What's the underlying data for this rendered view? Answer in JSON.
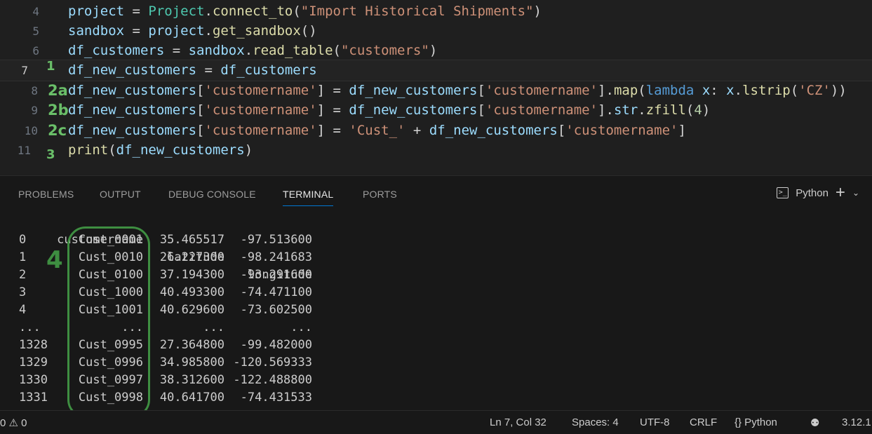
{
  "editor": {
    "lines": [
      {
        "num": "4",
        "ann": "",
        "code": [
          [
            "var",
            "project"
          ],
          [
            "op",
            " = "
          ],
          [
            "cls",
            "Project"
          ],
          [
            "op",
            "."
          ],
          [
            "fn",
            "connect_to"
          ],
          [
            "op",
            "("
          ],
          [
            "str",
            "\"Import Historical Shipments\""
          ],
          [
            "op",
            ")"
          ]
        ]
      },
      {
        "num": "5",
        "ann": "",
        "code": [
          [
            "var",
            "sandbox"
          ],
          [
            "op",
            " = "
          ],
          [
            "var",
            "project"
          ],
          [
            "op",
            "."
          ],
          [
            "fn",
            "get_sandbox"
          ],
          [
            "op",
            "()"
          ]
        ]
      },
      {
        "num": "6",
        "ann": "",
        "code": [
          [
            "var",
            "df_customers"
          ],
          [
            "op",
            " = "
          ],
          [
            "var",
            "sandbox"
          ],
          [
            "op",
            "."
          ],
          [
            "fn",
            "read_table"
          ],
          [
            "op",
            "("
          ],
          [
            "str",
            "\"customers\""
          ],
          [
            "op",
            ")"
          ]
        ]
      },
      {
        "num": "7",
        "ann": "1",
        "code": [
          [
            "var",
            "df_new_customers"
          ],
          [
            "op",
            " = "
          ],
          [
            "var",
            "df_customers"
          ]
        ]
      },
      {
        "num": "8",
        "ann": "2a",
        "code": [
          [
            "var",
            "df_new_customers"
          ],
          [
            "op",
            "["
          ],
          [
            "str",
            "'customername'"
          ],
          [
            "op",
            "] = "
          ],
          [
            "var",
            "df_new_customers"
          ],
          [
            "op",
            "["
          ],
          [
            "str",
            "'customername'"
          ],
          [
            "op",
            "]."
          ],
          [
            "fn",
            "map"
          ],
          [
            "op",
            "("
          ],
          [
            "kw",
            "lambda"
          ],
          [
            "op",
            " "
          ],
          [
            "var",
            "x"
          ],
          [
            "op",
            ": "
          ],
          [
            "var",
            "x"
          ],
          [
            "op",
            "."
          ],
          [
            "fn",
            "lstrip"
          ],
          [
            "op",
            "("
          ],
          [
            "str",
            "'CZ'"
          ],
          [
            "op",
            "))"
          ]
        ]
      },
      {
        "num": "9",
        "ann": "2b",
        "code": [
          [
            "var",
            "df_new_customers"
          ],
          [
            "op",
            "["
          ],
          [
            "str",
            "'customername'"
          ],
          [
            "op",
            "] = "
          ],
          [
            "var",
            "df_new_customers"
          ],
          [
            "op",
            "["
          ],
          [
            "str",
            "'customername'"
          ],
          [
            "op",
            "]."
          ],
          [
            "var",
            "str"
          ],
          [
            "op",
            "."
          ],
          [
            "fn",
            "zfill"
          ],
          [
            "op",
            "("
          ],
          [
            "num",
            "4"
          ],
          [
            "op",
            ")"
          ]
        ]
      },
      {
        "num": "10",
        "ann": "2c",
        "code": [
          [
            "var",
            "df_new_customers"
          ],
          [
            "op",
            "["
          ],
          [
            "str",
            "'customername'"
          ],
          [
            "op",
            "] = "
          ],
          [
            "str",
            "'Cust_'"
          ],
          [
            "op",
            " + "
          ],
          [
            "var",
            "df_new_customers"
          ],
          [
            "op",
            "["
          ],
          [
            "str",
            "'customername'"
          ],
          [
            "op",
            "]"
          ]
        ]
      },
      {
        "num": "11",
        "ann": "3",
        "code": [
          [
            "fn",
            "print"
          ],
          [
            "op",
            "("
          ],
          [
            "var",
            "df_new_customers"
          ],
          [
            "op",
            ")"
          ]
        ]
      }
    ]
  },
  "panel": {
    "tabs": [
      "PROBLEMS",
      "OUTPUT",
      "DEBUG CONSOLE",
      "TERMINAL",
      "PORTS"
    ],
    "active_tab": "TERMINAL",
    "terminal_label": "Python",
    "plus": "+",
    "chevron": "⌄"
  },
  "terminal": {
    "headers": [
      "customername",
      "latitude",
      "longitude"
    ],
    "rows": [
      [
        "0",
        "Cust_0001",
        "35.465517",
        "-97.513600"
      ],
      [
        "1",
        "Cust_0010",
        "26.227300",
        "-98.241683"
      ],
      [
        "2",
        "Cust_0100",
        "37.194300",
        "-93.291600"
      ],
      [
        "3",
        "Cust_1000",
        "40.493300",
        "-74.471100"
      ],
      [
        "4",
        "Cust_1001",
        "40.629600",
        "-73.602500"
      ],
      [
        "...",
        "...",
        "...",
        "..."
      ],
      [
        "1328",
        "Cust_0995",
        "27.364800",
        "-99.482000"
      ],
      [
        "1329",
        "Cust_0996",
        "34.985800",
        "-120.569333"
      ],
      [
        "1330",
        "Cust_0997",
        "38.312600",
        "-122.488800"
      ],
      [
        "1331",
        "Cust_0998",
        "40.641700",
        "-74.431533"
      ]
    ],
    "annotation": "4"
  },
  "status": {
    "problems": "0 ⚠ 0",
    "position": "Ln 7, Col 32",
    "spaces": "Spaces: 4",
    "encoding": "UTF-8",
    "eol": "CRLF",
    "language": "{} Python",
    "version": "3.12.1"
  },
  "colors": {
    "accent": "#0078d4",
    "annotation": "#3e8e41"
  }
}
